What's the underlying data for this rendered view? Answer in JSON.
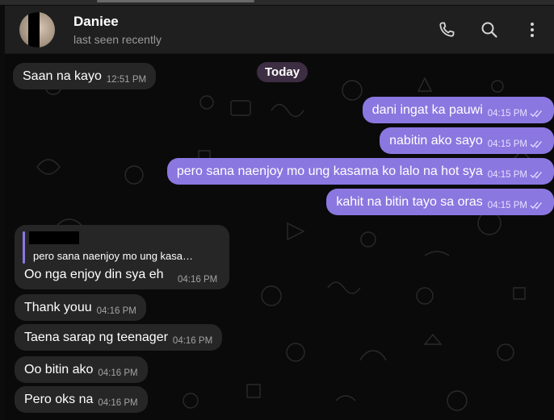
{
  "header": {
    "contact_name": "Daniee",
    "status": "last seen recently",
    "icons": [
      "phone-icon",
      "search-icon",
      "more-vertical-icon"
    ]
  },
  "chat": {
    "date_badge": "Today",
    "messages": [
      {
        "direction": "incoming",
        "text": "Saan na kayo",
        "time": "12:51 PM"
      },
      {
        "direction": "outgoing",
        "text": "dani ingat ka pauwi",
        "time": "04:15 PM",
        "read": true
      },
      {
        "direction": "outgoing",
        "text": "nabitin ako sayo",
        "time": "04:15 PM",
        "read": true
      },
      {
        "direction": "outgoing",
        "text": "pero sana naenjoy mo ung kasama ko lalo na hot sya",
        "time": "04:15 PM",
        "read": true
      },
      {
        "direction": "outgoing",
        "text": "kahit na bitin tayo sa oras",
        "time": "04:15 PM",
        "read": true
      },
      {
        "direction": "incoming",
        "quote": "pero sana naenjoy mo ung kasa…",
        "text": "Oo nga enjoy din sya eh",
        "time": "04:16 PM"
      },
      {
        "direction": "incoming",
        "text": "Thank youu",
        "time": "04:16 PM"
      },
      {
        "direction": "incoming",
        "text": "Taena sarap ng teenager",
        "time": "04:16 PM"
      },
      {
        "direction": "incoming",
        "text": "Oo bitin ako",
        "time": "04:16 PM"
      },
      {
        "direction": "incoming",
        "text": "Pero oks na",
        "time": "04:16 PM"
      }
    ]
  },
  "colors": {
    "outgoing_bubble": "#8b77e0",
    "incoming_bubble": "#262626",
    "header_bg": "#1f1f1f",
    "chat_bg": "#0a0a0a",
    "date_badge_bg": "#3d2e43"
  }
}
